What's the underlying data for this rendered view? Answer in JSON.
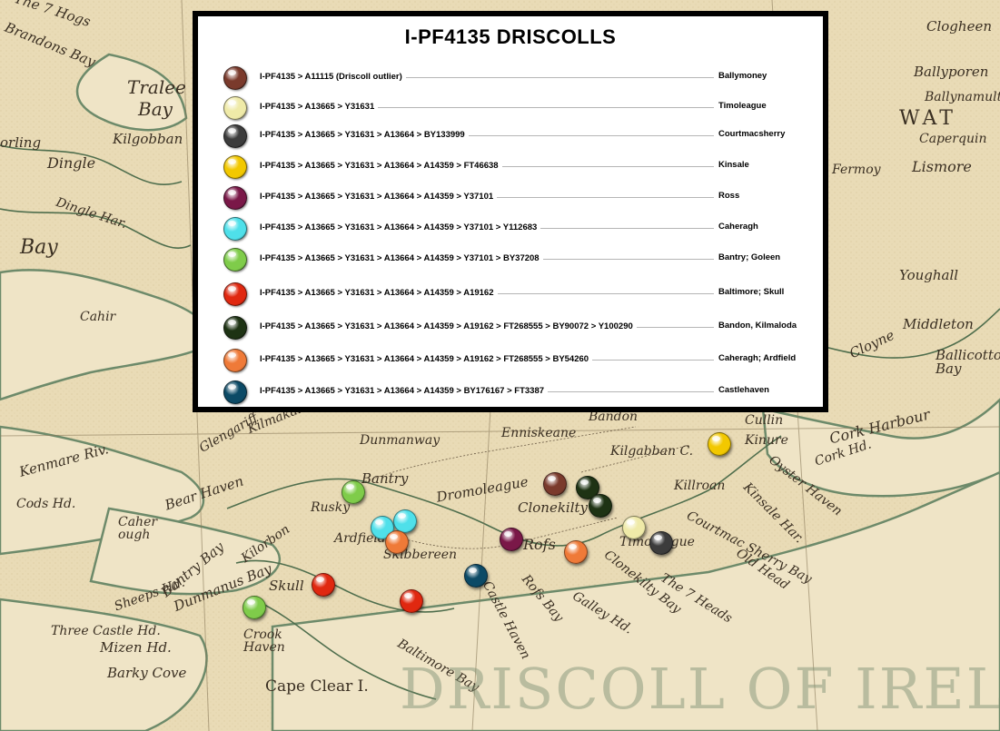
{
  "legend": {
    "title": "I-PF4135 DRISCOLLS",
    "rows": [
      {
        "path": "I-PF4135 > A11115 (Driscoll outlier)",
        "place": "Ballymoney",
        "color": "#7a3a2c"
      },
      {
        "path": "I-PF4135 > A13665 > Y31631",
        "place": "Timoleague",
        "color": "#efeaa8"
      },
      {
        "path": "I-PF4135 > A13665 > Y31631 > A13664 > BY133999",
        "place": "Courtmacsherry",
        "color": "#3c3c3c"
      },
      {
        "path": "I-PF4135 > A13665 > Y31631 > A13664 > A14359 > FT46638",
        "place": "Kinsale",
        "color": "#f2c800"
      },
      {
        "path": "I-PF4135 > A13665 > Y31631 > A13664 > A14359 > Y37101",
        "place": "Ross",
        "color": "#7a1848"
      },
      {
        "path": "I-PF4135 > A13665 > Y31631 > A13664 > A14359 > Y37101 > Y112683",
        "place": "Caheragh",
        "color": "#4fe0ea"
      },
      {
        "path": "I-PF4135 > A13665 > Y31631 > A13664 > A14359 > Y37101 > BY37208",
        "place": "Bantry; Goleen",
        "color": "#7fcc4a"
      },
      {
        "path": "I-PF4135 > A13665 > Y31631 > A13664 > A14359 > A19162",
        "place": "Baltimore; Skull",
        "color": "#e02810"
      },
      {
        "path": "I-PF4135 > A13665 > Y31631 > A13664 > A14359 > A19162 > FT268555 > BY90072 > Y100290",
        "place": "Bandon, Kilmaloda",
        "color": "#1e3314"
      },
      {
        "path": "I-PF4135 > A13665 > Y31631 > A13664 > A14359 > A19162 > FT268555 > BY54260",
        "place": "Caheragh; Ardfield",
        "color": "#ef7a38"
      },
      {
        "path": "I-PF4135 > A13665 > Y31631 > A13664 > A14359 > BY176167 > FT3387",
        "place": "Castlehaven",
        "color": "#0c4a66"
      }
    ]
  },
  "map_labels": [
    {
      "text": "The 7 Hogs",
      "size": 15
    },
    {
      "text": "Brandons Bay",
      "size": 15
    },
    {
      "text": "Tralee",
      "size": 20
    },
    {
      "text": "Bay",
      "size": 20
    },
    {
      "text": "Kilgobban",
      "size": 15
    },
    {
      "text": "Dingle",
      "size": 16
    },
    {
      "text": "Dingle Har.",
      "size": 14
    },
    {
      "text": "Bay",
      "size": 22
    },
    {
      "text": "orling",
      "size": 15
    },
    {
      "text": "Cahir",
      "size": 14
    },
    {
      "text": "Clogheen",
      "size": 15
    },
    {
      "text": "Ballyporen",
      "size": 15
    },
    {
      "text": "Ballynamult",
      "size": 14
    },
    {
      "text": "WAT",
      "size": 22
    },
    {
      "text": "Caperquin",
      "size": 14
    },
    {
      "text": "Fermoy",
      "size": 14
    },
    {
      "text": "Lismore",
      "size": 16
    },
    {
      "text": "Youghall",
      "size": 15
    },
    {
      "text": "Middleton",
      "size": 15
    },
    {
      "text": "Cloyne",
      "size": 15
    },
    {
      "text": "Ballicotton Bay",
      "size": 15
    },
    {
      "text": "Bandon",
      "size": 14
    },
    {
      "text": "Enniskeane",
      "size": 14
    },
    {
      "text": "Kilgabban C.",
      "size": 14
    },
    {
      "text": "Cullin",
      "size": 14
    },
    {
      "text": "Kinure",
      "size": 14
    },
    {
      "text": "Cork Harbour",
      "size": 16
    },
    {
      "text": "Cork Hd.",
      "size": 14
    },
    {
      "text": "Kilmakaloge",
      "size": 14
    },
    {
      "text": "Dunmanway",
      "size": 14
    },
    {
      "text": "Kenmare Riv.",
      "size": 15
    },
    {
      "text": "Cods Hd.",
      "size": 14
    },
    {
      "text": "Bear Haven",
      "size": 15
    },
    {
      "text": "Bantry",
      "size": 15
    },
    {
      "text": "Rusky",
      "size": 14
    },
    {
      "text": "Dromoleague",
      "size": 15
    },
    {
      "text": "Clonekilty",
      "size": 15
    },
    {
      "text": "Killroan",
      "size": 14
    },
    {
      "text": "Oyster Haven",
      "size": 14
    },
    {
      "text": "Kinsale Har.",
      "size": 14
    },
    {
      "text": "Caher ough",
      "size": 14
    },
    {
      "text": "Bantry Bay",
      "size": 15
    },
    {
      "text": "Kilorbon",
      "size": 14
    },
    {
      "text": "Ardfield",
      "size": 14
    },
    {
      "text": "Skibbereen",
      "size": 14
    },
    {
      "text": "Rofs",
      "size": 16
    },
    {
      "text": "Timoleague",
      "size": 14
    },
    {
      "text": "Courtmac Sherry Bay",
      "size": 14
    },
    {
      "text": "Old Head",
      "size": 14
    },
    {
      "text": "Sheeps Hd.",
      "size": 14
    },
    {
      "text": "Dunmanus Bay",
      "size": 15
    },
    {
      "text": "Skull",
      "size": 15
    },
    {
      "text": "Clonekilty Bay",
      "size": 14
    },
    {
      "text": "Rofs Bay",
      "size": 14
    },
    {
      "text": "Galley Hd.",
      "size": 14
    },
    {
      "text": "The 7 Heads",
      "size": 14
    },
    {
      "text": "Three Castle Hd.",
      "size": 14
    },
    {
      "text": "Mizen Hd.",
      "size": 15
    },
    {
      "text": "Crook Haven",
      "size": 14
    },
    {
      "text": "Barky Cove",
      "size": 15
    },
    {
      "text": "Castle Haven",
      "size": 14
    },
    {
      "text": "Baltimore Bay",
      "size": 14
    },
    {
      "text": "Cape Clear I.",
      "size": 17
    },
    {
      "text": "Glengariff",
      "size": 14
    }
  ],
  "watermark": "DRISCOLL OF IRELAND",
  "markers": [
    {
      "place": "Ballymoney",
      "color": "#7a3a2c"
    },
    {
      "place": "Bandon, Kilmaloda",
      "color": "#1e3314"
    },
    {
      "place": "Bandon, Kilmaloda",
      "color": "#1e3314"
    },
    {
      "place": "Kinsale",
      "color": "#f2c800"
    },
    {
      "place": "Bantry; Goleen",
      "color": "#7fcc4a"
    },
    {
      "place": "Caheragh",
      "color": "#4fe0ea"
    },
    {
      "place": "Caheragh",
      "color": "#4fe0ea"
    },
    {
      "place": "Caheragh; Ardfield",
      "color": "#ef7a38"
    },
    {
      "place": "Ross",
      "color": "#7a1848"
    },
    {
      "place": "Caheragh; Ardfield",
      "color": "#ef7a38"
    },
    {
      "place": "Timoleague",
      "color": "#efeaa8"
    },
    {
      "place": "Courtmacsherry",
      "color": "#3c3c3c"
    },
    {
      "place": "Castlehaven",
      "color": "#0c4a66"
    },
    {
      "place": "Baltimore; Skull",
      "color": "#e02810"
    },
    {
      "place": "Baltimore; Skull",
      "color": "#e02810"
    },
    {
      "place": "Bantry; Goleen",
      "color": "#7fcc4a"
    }
  ]
}
